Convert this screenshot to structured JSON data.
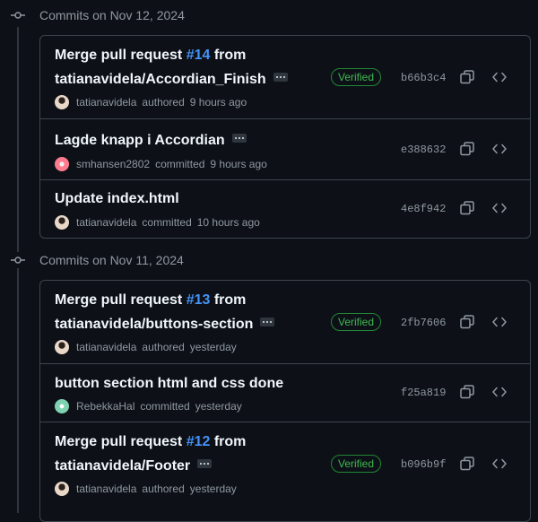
{
  "groups": [
    {
      "date": "Commits on Nov 12, 2024",
      "commits": [
        {
          "title_pre": "Merge pull request ",
          "pr": "#14",
          "title_post": " from",
          "title_line2": "tatianavidela/Accordian_Finish",
          "has_ellipsis": true,
          "author": "tatianavidela",
          "action": "authored",
          "time": "9 hours ago",
          "verified": "Verified",
          "sha": "b66b3c4",
          "avatar": "tv"
        },
        {
          "title_pre": "Lagde knapp i Accordian",
          "has_ellipsis": true,
          "author": "smhansen2802",
          "action": "committed",
          "time": "9 hours ago",
          "sha": "e388632",
          "avatar": "sm"
        },
        {
          "title_pre": "Update index.html",
          "author": "tatianavidela",
          "action": "committed",
          "time": "10 hours ago",
          "sha": "4e8f942",
          "avatar": "tv"
        }
      ]
    },
    {
      "date": "Commits on Nov 11, 2024",
      "commits": [
        {
          "title_pre": "Merge pull request ",
          "pr": "#13",
          "title_post": " from",
          "title_line2": "tatianavidela/buttons-section",
          "has_ellipsis": true,
          "author": "tatianavidela",
          "action": "authored",
          "time": "yesterday",
          "verified": "Verified",
          "sha": "2fb7606",
          "avatar": "tv"
        },
        {
          "title_pre": "button section html and css done",
          "author": "RebekkaHal",
          "action": "committed",
          "time": "yesterday",
          "sha": "f25a819",
          "avatar": "rh"
        },
        {
          "title_pre": "Merge pull request ",
          "pr": "#12",
          "title_post": " from",
          "title_line2": "tatianavidela/Footer",
          "has_ellipsis": true,
          "author": "tatianavidela",
          "action": "authored",
          "time": "yesterday",
          "verified": "Verified",
          "sha": "b096b9f",
          "avatar": "tv"
        }
      ]
    }
  ],
  "icons": {
    "commit": "git-commit-icon",
    "copy": "copy-icon",
    "browse": "code-icon"
  },
  "colors": {
    "background": "#0d1117",
    "border": "#3d444d",
    "link": "#4493f8",
    "verified": "#3fb950",
    "muted": "#9198a1"
  }
}
